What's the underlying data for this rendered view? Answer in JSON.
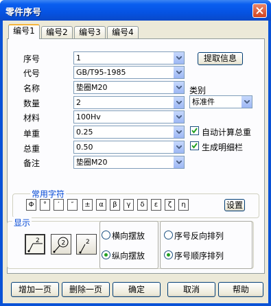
{
  "window": {
    "title": "零件序号"
  },
  "tabs": [
    {
      "label": "编号1"
    },
    {
      "label": "编号2"
    },
    {
      "label": "编号3"
    },
    {
      "label": "编号4"
    }
  ],
  "fields": [
    {
      "label": "序号",
      "value": "1"
    },
    {
      "label": "代号",
      "value": "GB/T95-1985"
    },
    {
      "label": "名称",
      "value": "垫圈M20"
    },
    {
      "label": "数量",
      "value": "2"
    },
    {
      "label": "材料",
      "value": "100Hv"
    },
    {
      "label": "单重",
      "value": "0.25"
    },
    {
      "label": "总重",
      "value": "0.50"
    },
    {
      "label": "备注",
      "value": "垫圈M20"
    }
  ],
  "extract_button": "提取信息",
  "category": {
    "label": "类别",
    "value": "标准件"
  },
  "checkboxes": [
    {
      "label": "自动计算总重",
      "checked": true
    },
    {
      "label": "生成明细栏",
      "checked": true
    }
  ],
  "symbols": {
    "title": "常用字符",
    "items": [
      "Φ",
      "°",
      "′",
      "″",
      "±",
      "α",
      "β",
      "γ",
      "δ",
      "ε",
      "ζ",
      "η"
    ],
    "settings_button": "设置"
  },
  "display": {
    "title": "显示",
    "style_buttons": [
      {
        "icon": "leader-flag-icon",
        "text": "2"
      },
      {
        "icon": "leader-circle-icon",
        "text": "2"
      },
      {
        "icon": "leader-plain-icon",
        "text": "2"
      }
    ],
    "orientation_options": [
      {
        "label": "横向摆放",
        "selected": false
      },
      {
        "label": "纵向摆放",
        "selected": true
      }
    ],
    "order_options": [
      {
        "label": "序号反向排列",
        "selected": false
      },
      {
        "label": "序号顺序排列",
        "selected": true
      }
    ]
  },
  "footer_buttons": {
    "add_page": "增加一页",
    "delete_page": "删除一页",
    "ok": "确定",
    "cancel": "取消",
    "help": "帮助"
  },
  "colors": {
    "titlebar": "#0553e3",
    "dialog_bg": "#ece9d8",
    "accent_tab": "#f5b43a",
    "group_title": "#0046d5",
    "check_green": "#21a121"
  }
}
